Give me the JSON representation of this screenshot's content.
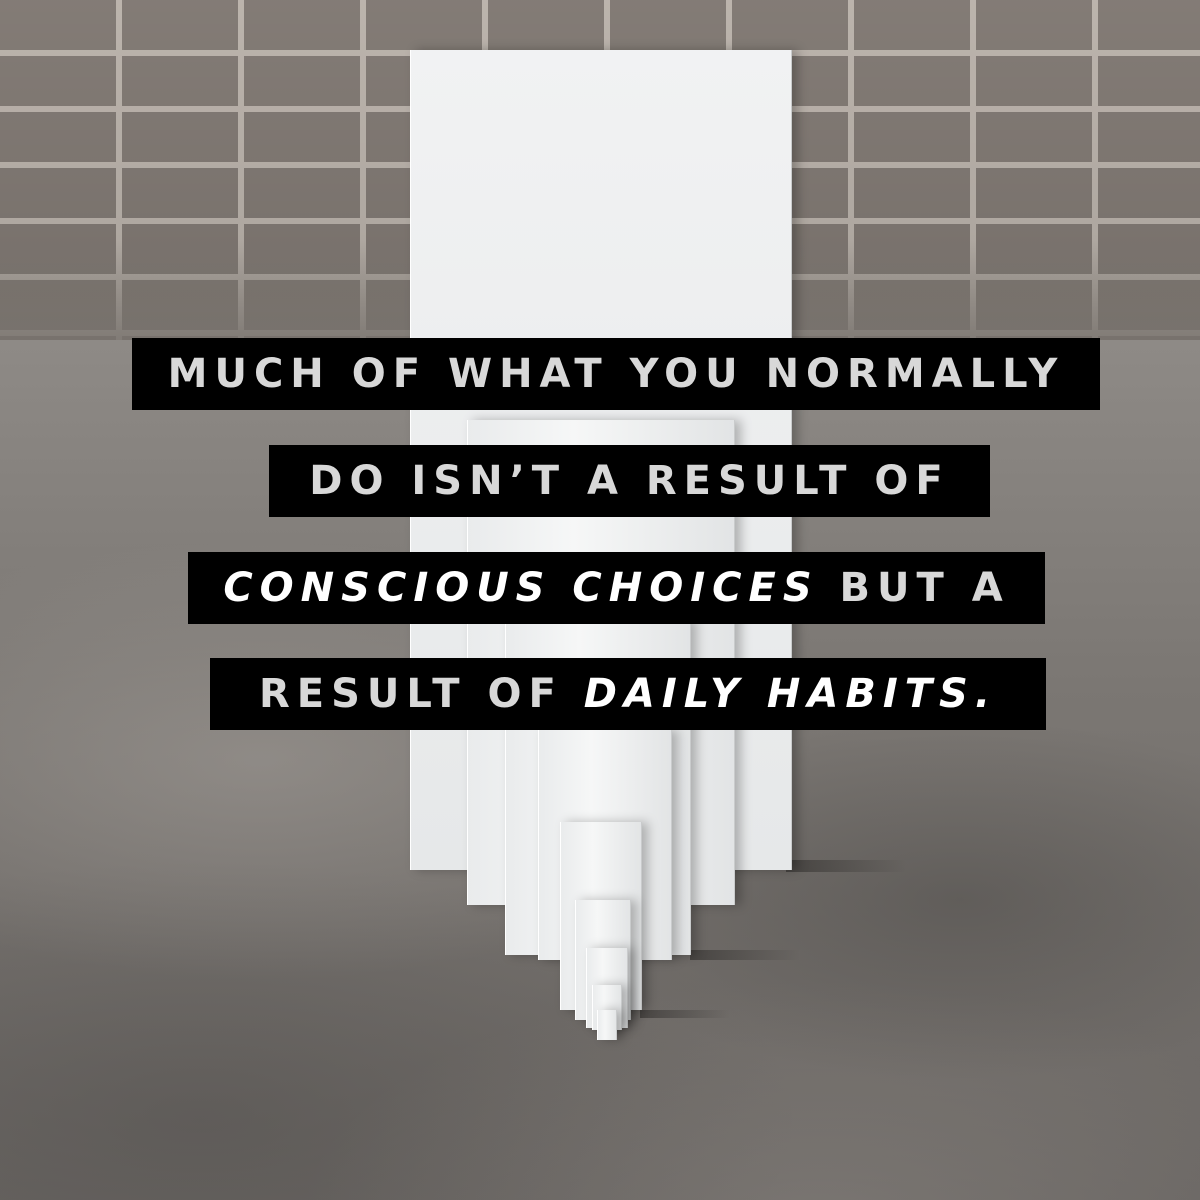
{
  "quote": {
    "line1": {
      "text": "MUCH OF WHAT YOU NORMALLY"
    },
    "line2": {
      "text": "DO ISN’T A RESULT OF"
    },
    "line3": {
      "emphasis": "CONSCIOUS CHOICES",
      "text": " BUT A"
    },
    "line4": {
      "text": "RESULT OF ",
      "emphasis": "DAILY HABITS",
      "tail": "."
    }
  },
  "colors": {
    "banner": "#000000",
    "text": "#d8d8d8",
    "emphasis": "#ffffff",
    "blocks": "#f2f3f4"
  }
}
